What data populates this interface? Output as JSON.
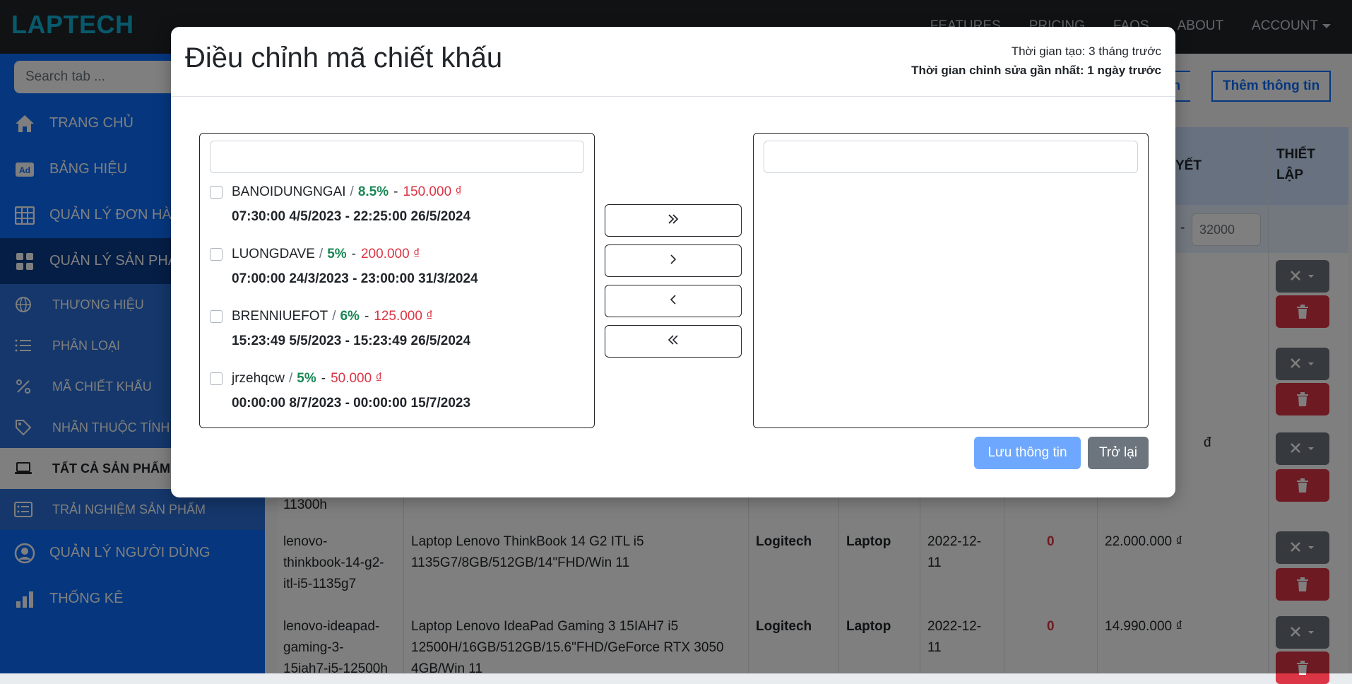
{
  "navbar": {
    "brand": "LAPTECH",
    "links": [
      "FEATURES",
      "PRICING",
      "FAQS",
      "ABOUT"
    ],
    "account": "ACCOUNT"
  },
  "sidebar": {
    "search_placeholder": "Search tab ...",
    "items": [
      {
        "label": "TRANG CHỦ",
        "icon": "home-icon"
      },
      {
        "label": "BẢNG HIỆU",
        "icon": "ad-icon"
      },
      {
        "label": "QUẢN LÝ ĐƠN HÀNG",
        "icon": "table-icon"
      },
      {
        "label": "QUẢN LÝ SẢN PHẨM",
        "icon": "grid-icon"
      }
    ],
    "sub_items": [
      {
        "label": "THƯƠNG HIỆU",
        "icon": "globe-icon"
      },
      {
        "label": "PHÂN LOẠI",
        "icon": "list-icon"
      },
      {
        "label": "MÃ CHIẾT KHẤU",
        "icon": "percent-icon"
      },
      {
        "label": "NHÃN THUỘC TÍNH",
        "icon": "tag-icon"
      },
      {
        "label": "TẤT CẢ SẢN PHẨM",
        "icon": "laptop-icon"
      },
      {
        "label": "TRẢI NGHIỆM SẢN PHẨM",
        "icon": "card-list-icon"
      }
    ],
    "bottom_items": [
      {
        "label": "QUẢN LÝ NGƯỜI DÙNG",
        "icon": "user-circle-icon"
      },
      {
        "label": "THỐNG KÊ",
        "icon": "bar-chart-icon"
      }
    ]
  },
  "main": {
    "buttons": [
      "g tin",
      "Thêm thông tin"
    ],
    "headers": {
      "detail": "YẾT",
      "settings_line1": "THIẾT",
      "settings_line2": "LẬP"
    },
    "filter_dash": "-",
    "filter_value": "32000",
    "rows": [
      {
        "slug": [
          "11300h"
        ],
        "name": [],
        "brand": "",
        "category": "",
        "date": [],
        "stock": "",
        "price": "đ"
      },
      {
        "slug": [
          "lenovo-",
          "thinkbook-14-g2-",
          "itl-i5-1135g7"
        ],
        "name": [
          "Laptop Lenovo ThinkBook 14 G2 ITL i5",
          "1135G7/8GB/512GB/14\"FHD/Win 11"
        ],
        "brand": "Logitech",
        "category": "Laptop",
        "date": [
          "2022-12-",
          "11"
        ],
        "stock": "0",
        "price": "22.000.000 ₫"
      },
      {
        "slug": [
          "lenovo-ideapad-",
          "gaming-3-",
          "15iah7-i5-12500h"
        ],
        "name": [
          "Laptop Lenovo IdeaPad Gaming 3 15IAH7 i5",
          "12500H/16GB/512GB/15.6\"FHD/GeForce RTX 3050",
          "4GB/Win 11"
        ],
        "brand": "Logitech",
        "category": "Laptop",
        "date": [
          "2022-12-",
          "11"
        ],
        "stock": "0",
        "price": "14.990.000 ₫"
      }
    ]
  },
  "modal": {
    "title": "Điều chỉnh mã chiết khấu",
    "created": "Thời gian tạo: 3 tháng trước",
    "modified": "Thời gian chỉnh sửa gần nhất: 1 ngày trước",
    "left_search_value": "",
    "right_search_value": "",
    "slash": "/",
    "dash": "-",
    "discounts": [
      {
        "code": "BANOIDUNGNGAI",
        "percent": "8.5%",
        "amount": "150.000 ₫",
        "period": "07:30:00 4/5/2023 - 22:25:00 26/5/2024"
      },
      {
        "code": "LUONGDAVE",
        "percent": "5%",
        "amount": "200.000 ₫",
        "period": "07:00:00 24/3/2023 - 23:00:00 31/3/2024"
      },
      {
        "code": "BRENNIUEFOT",
        "percent": "6%",
        "amount": "125.000 ₫",
        "period": "15:23:49 5/5/2023 - 15:23:49 26/5/2024"
      },
      {
        "code": "jrzehqcw",
        "percent": "5%",
        "amount": "50.000 ₫",
        "period": "00:00:00 8/7/2023 - 00:00:00 15/7/2023"
      }
    ],
    "transfer_buttons": [
      "move-all-right",
      "move-right",
      "move-left",
      "move-all-left"
    ],
    "save_label": "Lưu thông tin",
    "back_label": "Trở lại"
  },
  "colors": {
    "navbar": "#212529",
    "brand": "#13b3d8",
    "sidebar": "#0d6efd",
    "percent": "#198754",
    "amount": "#dc3545",
    "save": "#6ea8fe",
    "back": "#6c757d"
  }
}
